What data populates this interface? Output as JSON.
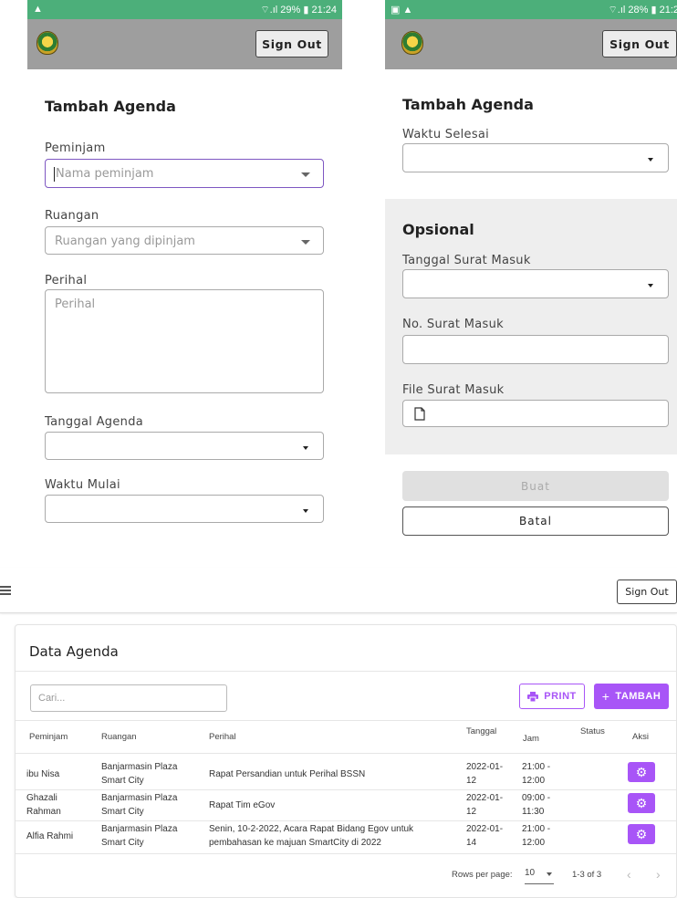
{
  "phone_left": {
    "statusbar": {
      "left_icons": "▲",
      "right_text": "⌔.ıl 29% ▮ 21:24"
    },
    "signout_label": "Sign Out",
    "title": "Tambah Agenda",
    "fields": {
      "peminjam": {
        "label": "Peminjam",
        "placeholder": "Nama peminjam"
      },
      "ruangan": {
        "label": "Ruangan",
        "placeholder": "Ruangan yang dipinjam"
      },
      "perihal": {
        "label": "Perihal",
        "placeholder": "Perihal"
      },
      "tanggal_agenda": {
        "label": "Tanggal Agenda",
        "value": ""
      },
      "waktu_mulai": {
        "label": "Waktu Mulai",
        "value": ""
      }
    }
  },
  "phone_right": {
    "statusbar": {
      "left_icons": "▣ ▲",
      "right_text": "⌔.ıl 28% ▮ 21:2"
    },
    "signout_label": "Sign Out",
    "title": "Tambah Agenda",
    "fields": {
      "waktu_selesai": {
        "label": "Waktu Selesai",
        "value": ""
      }
    },
    "opsional": {
      "title": "Opsional",
      "tanggal_surat_masuk": {
        "label": "Tanggal Surat Masuk",
        "value": ""
      },
      "no_surat_masuk": {
        "label": "No. Surat Masuk",
        "value": ""
      },
      "file_surat_masuk": {
        "label": "File Surat Masuk"
      }
    },
    "buttons": {
      "buat": "Buat",
      "batal": "Batal"
    }
  },
  "desktop": {
    "signout_label": "Sign Out",
    "title": "Data Agenda",
    "search_placeholder": "Cari...",
    "print_label": "PRINT",
    "tambah_label": "TAMBAH",
    "columns": [
      "Peminjam",
      "Ruangan",
      "Perihal",
      "Tanggal",
      "Jam",
      "Status",
      "Aksi"
    ],
    "rows": [
      {
        "peminjam": "ibu Nisa",
        "ruangan": [
          "Banjarmasin Plaza",
          "Smart City"
        ],
        "perihal": [
          "Rapat Persandian untuk Perihal BSSN"
        ],
        "tanggal": [
          "2022-01-",
          "12"
        ],
        "jam": [
          "21:00 -",
          "12:00"
        ],
        "status": ""
      },
      {
        "peminjam": "Ghazali Rahman",
        "peminjam_lines": [
          "Ghazali",
          "Rahman"
        ],
        "ruangan": [
          "Banjarmasin Plaza",
          "Smart City"
        ],
        "perihal": [
          "Rapat Tim eGov"
        ],
        "tanggal": [
          "2022-01-",
          "12"
        ],
        "jam": [
          "09:00 -",
          "11:30"
        ],
        "status": ""
      },
      {
        "peminjam": "Alfia Rahmi",
        "ruangan": [
          "Banjarmasin Plaza",
          "Smart City"
        ],
        "perihal": [
          "Senin, 10-2-2022, Acara Rapat Bidang Egov untuk",
          "pembahasan ke majuan SmartCity di 2022"
        ],
        "tanggal": [
          "2022-01-",
          "14"
        ],
        "jam": [
          "21:00 -",
          "12:00"
        ],
        "status": ""
      }
    ],
    "footer": {
      "rows_per_page_label": "Rows per page:",
      "rows_per_page_value": "10",
      "range": "1-3 of 3"
    },
    "colors": {
      "accent": "#a855f7",
      "statusbar": "#4caf7a",
      "appbar": "#9e9e9e"
    }
  }
}
